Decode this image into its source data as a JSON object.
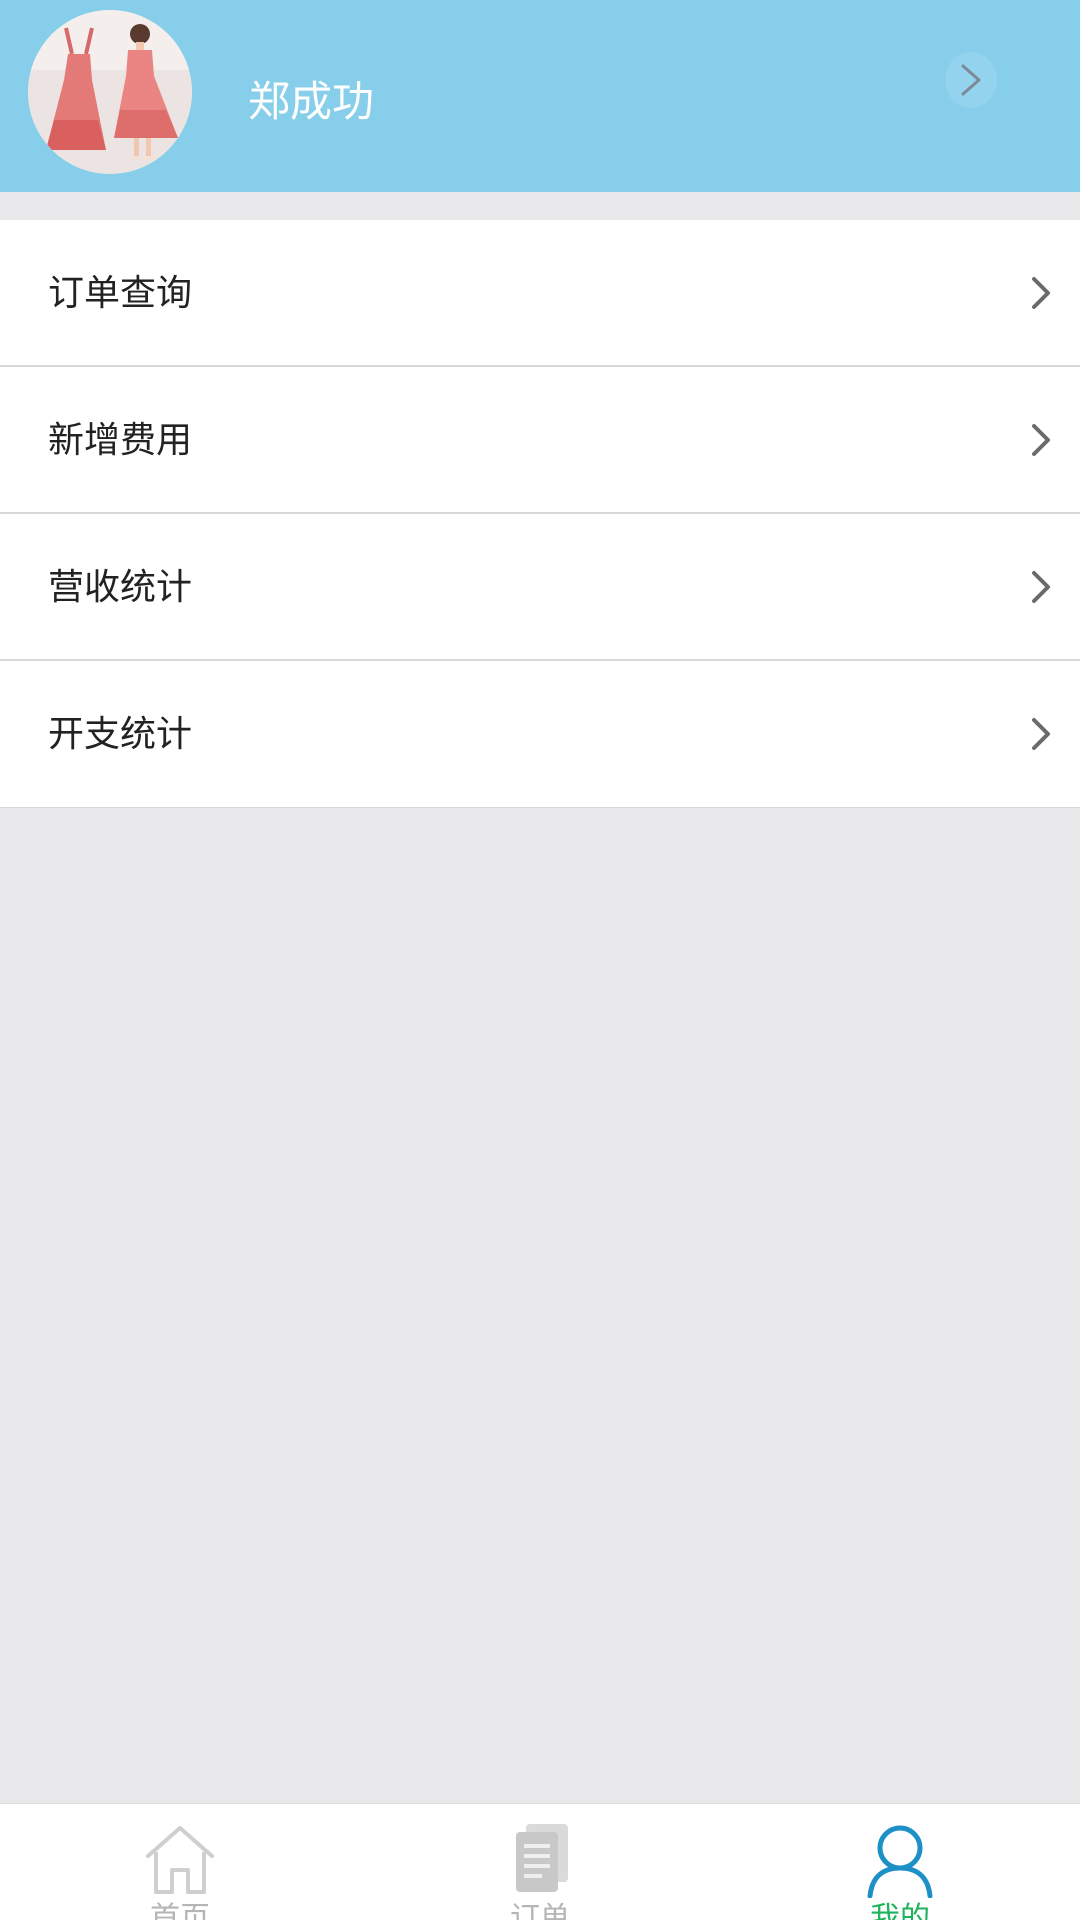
{
  "header": {
    "username": "郑成功",
    "avatar_icon": "dress-photo-avatar",
    "chevron_icon": "chevron-right-icon"
  },
  "menu": {
    "items": [
      {
        "label": "订单查询",
        "icon": "chevron-right-icon"
      },
      {
        "label": "新增费用",
        "icon": "chevron-right-icon"
      },
      {
        "label": "营收统计",
        "icon": "chevron-right-icon"
      },
      {
        "label": "开支统计",
        "icon": "chevron-right-icon"
      }
    ]
  },
  "bottom_nav": {
    "items": [
      {
        "label": "首页",
        "icon": "home-icon",
        "active": false
      },
      {
        "label": "订单",
        "icon": "document-icon",
        "active": false
      },
      {
        "label": "我的",
        "icon": "user-icon",
        "active": true
      }
    ]
  },
  "colors": {
    "header_bg": "#87ceeb",
    "page_bg": "#e8e8ea",
    "active_tab_text": "#1eb35c",
    "active_tab_icon": "#1e90c8",
    "inactive_tab": "#c8c8c8"
  }
}
